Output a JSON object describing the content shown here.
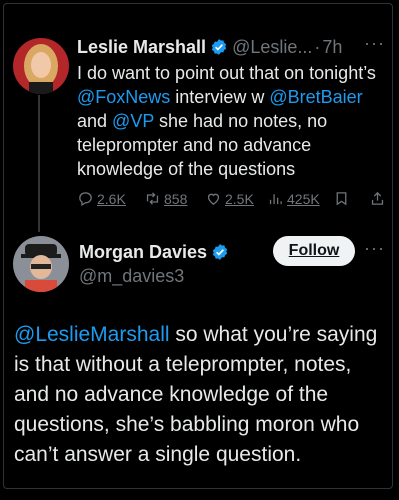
{
  "colors": {
    "background": "#000000",
    "accent": "#1d9bf0",
    "muted": "#71767b",
    "text": "#e7e9ea"
  },
  "tweet1": {
    "author_name": "Leslie Marshall",
    "handle": "@Leslie...",
    "separator": "·",
    "time": "7h",
    "more_icon": "more-dots-icon",
    "text_parts": [
      "I do want to point out that on tonight’s ",
      "@FoxNews",
      " interview w ",
      "@BretBaier",
      " and ",
      "@VP",
      " she had no notes, no teleprompter and no advance knowledge of the questions"
    ],
    "replies": "2.6K",
    "retweets": "858",
    "likes": "2.5K",
    "views": "425K"
  },
  "tweet2": {
    "author_name": "Morgan Davies",
    "handle": "@m_davies3",
    "follow_label": "Follow",
    "more_icon": "more-dots-icon",
    "mention": "@LeslieMarshall",
    "text": " so what you’re saying is that without a teleprompter, notes, and no advance knowledge of the questions, she’s babbling moron who can’t answer a single question."
  }
}
